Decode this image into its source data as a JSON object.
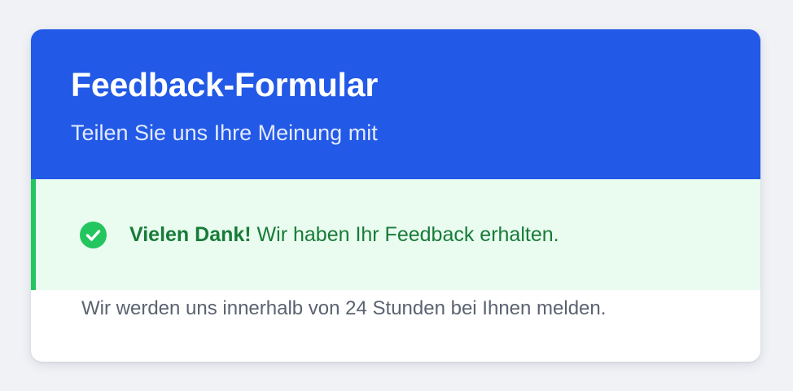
{
  "card": {
    "title": "Feedback-Formular",
    "subtitle": "Teilen Sie uns Ihre Meinung mit"
  },
  "success_message": {
    "icon": "check-circle-icon",
    "strong": "Vielen Dank!",
    "text": " Wir haben Ihr Feedback erhalten."
  },
  "followup": "Wir werden uns innerhalb von 24 Stunden bei Ihnen melden.",
  "colors": {
    "header_bg": "#2259e6",
    "success_bg": "#eafbf0",
    "success_border": "#22c55e",
    "success_text": "#177c38",
    "page_bg": "#f0f2f6"
  }
}
